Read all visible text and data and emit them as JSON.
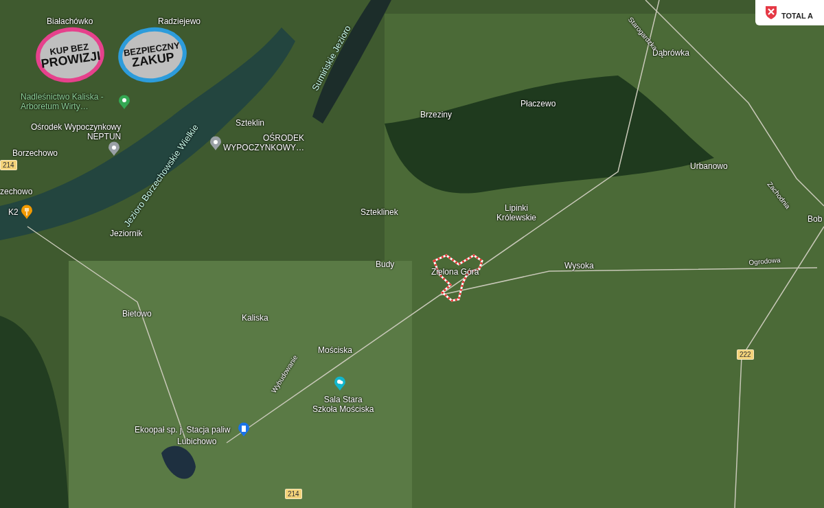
{
  "map": {
    "places": [
      {
        "name": "Białachówko"
      },
      {
        "name": "Radziejewo"
      },
      {
        "name": "Szteklin"
      },
      {
        "name": "Borzechowo"
      },
      {
        "name": "zechowo"
      },
      {
        "name": "Jeziornik"
      },
      {
        "name": "Szteklinek"
      },
      {
        "name": "Brzeziny"
      },
      {
        "name": "Płaczewo"
      },
      {
        "name": "Dąbrówka"
      },
      {
        "name": "Urbanowo"
      },
      {
        "name": "Lipinki\nKrólewskie"
      },
      {
        "name": "Budy"
      },
      {
        "name": "Zielona Góra"
      },
      {
        "name": "Wysoka"
      },
      {
        "name": "Bob"
      },
      {
        "name": "Bietowo"
      },
      {
        "name": "Kaliska"
      },
      {
        "name": "Mościska"
      },
      {
        "name": "Lubichowo"
      }
    ],
    "street_names": [
      {
        "name": "Starogardzka"
      },
      {
        "name": "Zachodnia"
      },
      {
        "name": "Ogrodowa"
      },
      {
        "name": "Wybudowanie"
      }
    ],
    "lakes": [
      {
        "name": "Sumińskie Jezioro"
      },
      {
        "name": "Jezioro Borzechowskie Wielkie"
      }
    ],
    "pois": [
      {
        "kind": "park",
        "name": "Nadleśnictwo Kaliska -\nArboretum Wirty…",
        "color": "#34a853"
      },
      {
        "kind": "place",
        "name": "Ośrodek Wypoczynkowy\nNEPTUN",
        "color": "#9aa0a6"
      },
      {
        "kind": "place",
        "name": "OŚRODEK\nWYPOCZYNKOWY…",
        "color": "#9aa0a6"
      },
      {
        "kind": "food",
        "name": "K2",
        "color": "#f29900"
      },
      {
        "kind": "culture",
        "name": "Sala Stara\nSzkoła Mościska",
        "color": "#12b5cb"
      },
      {
        "kind": "fuel",
        "name": "Ekoopał sp. j. Stacja paliw",
        "color": "#1a73e8"
      }
    ],
    "road_numbers": [
      {
        "number": "214"
      },
      {
        "number": "214"
      },
      {
        "number": "222"
      }
    ],
    "badges": [
      {
        "line1": "KUP BEZ",
        "line2": "PROWIZJI",
        "color": "#e6418c"
      },
      {
        "line1": "BEZPIECZNY",
        "line2": "ZAKUP",
        "color": "#2d9cdb"
      }
    ],
    "info_card": {
      "text": "TOTAL A"
    }
  }
}
